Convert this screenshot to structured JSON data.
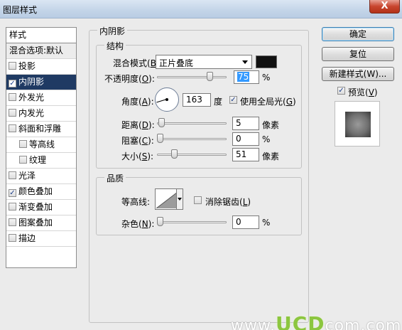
{
  "window": {
    "title": "图层样式",
    "close_label": "X"
  },
  "styles_panel": {
    "header": "样式",
    "blend_options": "混合选项:默认",
    "items": [
      {
        "label": "投影",
        "checked": false,
        "sub": false,
        "selected": false
      },
      {
        "label": "内阴影",
        "checked": true,
        "sub": false,
        "selected": true
      },
      {
        "label": "外发光",
        "checked": false,
        "sub": false,
        "selected": false
      },
      {
        "label": "内发光",
        "checked": false,
        "sub": false,
        "selected": false
      },
      {
        "label": "斜面和浮雕",
        "checked": false,
        "sub": false,
        "selected": false
      },
      {
        "label": "等高线",
        "checked": false,
        "sub": true,
        "selected": false
      },
      {
        "label": "纹理",
        "checked": false,
        "sub": true,
        "selected": false
      },
      {
        "label": "光泽",
        "checked": false,
        "sub": false,
        "selected": false
      },
      {
        "label": "颜色叠加",
        "checked": true,
        "sub": false,
        "selected": false
      },
      {
        "label": "渐变叠加",
        "checked": false,
        "sub": false,
        "selected": false
      },
      {
        "label": "图案叠加",
        "checked": false,
        "sub": false,
        "selected": false
      },
      {
        "label": "描边",
        "checked": false,
        "sub": false,
        "selected": false
      }
    ]
  },
  "inner_shadow": {
    "section_title": "内阴影",
    "structure": {
      "title": "结构",
      "blend_mode_label": "混合模式",
      "blend_mode_key": "B",
      "blend_mode_value": "正片叠底",
      "shadow_color": "#111111",
      "opacity_label": "不透明度",
      "opacity_key": "O",
      "opacity_value": "75",
      "percent": "%",
      "angle_label": "角度",
      "angle_key": "A",
      "angle_value": "163",
      "degree": "度",
      "global_light_label": "使用全局光",
      "global_light_key": "G",
      "global_light_checked": true,
      "distance_label": "距离",
      "distance_key": "D",
      "distance_value": "5",
      "choke_label": "阻塞",
      "choke_key": "C",
      "choke_value": "0",
      "size_label": "大小",
      "size_key": "S",
      "size_value": "51",
      "pixels": "像素"
    },
    "quality": {
      "title": "品质",
      "contour_label": "等高线",
      "antialias_label": "消除锯齿",
      "antialias_key": "L",
      "antialias_checked": false,
      "noise_label": "杂色",
      "noise_key": "N",
      "noise_value": "0",
      "percent": "%"
    }
  },
  "buttons": {
    "ok": "确定",
    "reset": "复位",
    "new_style": "新建样式(W)...",
    "preview_label": "预览",
    "preview_key": "V",
    "preview_checked": true
  },
  "watermark": {
    "prefix": "www.",
    "brand": "UCD",
    "suffix": "com.com"
  }
}
